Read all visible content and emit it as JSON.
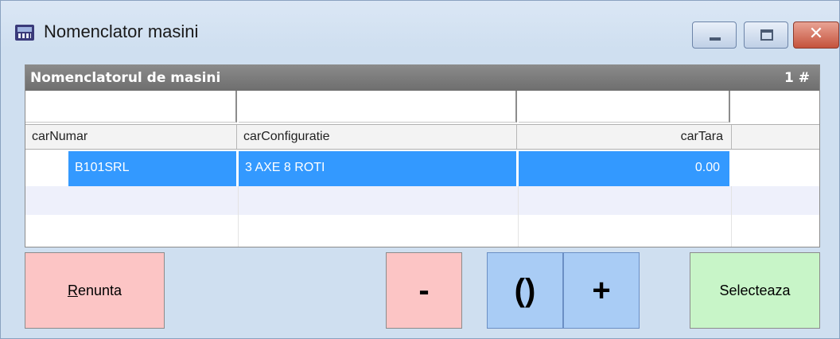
{
  "window": {
    "title": "Nomenclator masini",
    "controls": {
      "minimize": "minimize",
      "maximize": "maximize",
      "close": "✕"
    }
  },
  "grid": {
    "title": "Nomenclatorul de masini",
    "count": "1 #",
    "columns": [
      "carNumar",
      "carConfiguratie",
      "carTara"
    ],
    "rows": [
      {
        "carNumar": "B101SRL",
        "carConfiguratie": "3 AXE 8 ROTI",
        "carTara": "0.00"
      }
    ]
  },
  "buttons": {
    "renunta_first": "R",
    "renunta_rest": "enunta",
    "minus": "-",
    "paren": "()",
    "plus": "+",
    "selecteaza": "Selecteaza"
  },
  "colors": {
    "selection": "#3399ff",
    "cancel": "#fcc5c5",
    "action_blue": "#a9ccf5",
    "confirm": "#c8f5c8"
  }
}
